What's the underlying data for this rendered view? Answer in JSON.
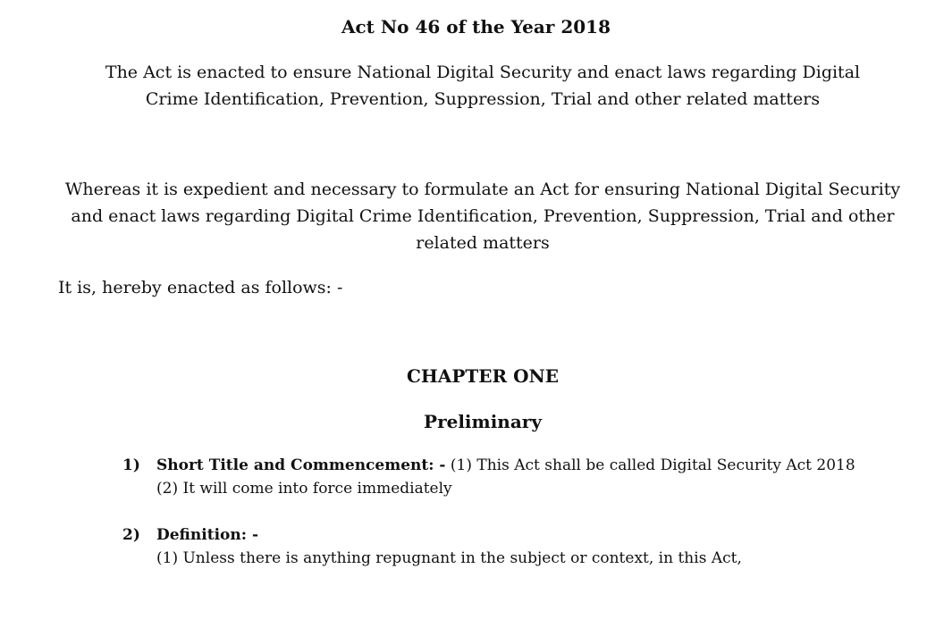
{
  "document": {
    "title": "Act No 46 of the Year 2018",
    "subtitle": "The Act is enacted to ensure National Digital Security and enact laws regarding Digital Crime Identification, Prevention, Suppression, Trial and other related matters",
    "preamble": "Whereas it is expedient and necessary to formulate an Act for ensuring National Digital Security and enact laws regarding Digital Crime Identification, Prevention, Suppression, Trial and other related matters",
    "enacted": "It is, hereby enacted as follows: -",
    "chapter": {
      "heading": "CHAPTER ONE",
      "subheading": "Preliminary"
    },
    "sections": [
      {
        "number": "1)",
        "heading": "Short Title and Commencement: -",
        "text": " (1) This Act shall be called  Digital Security Act  2018",
        "line2": "(2)  It will come into force immediately"
      },
      {
        "number": "2)",
        "heading": "Definition: -",
        "text": "",
        "line2": "(1)  Unless there is anything repugnant in the subject or context, in this Act,"
      }
    ]
  }
}
